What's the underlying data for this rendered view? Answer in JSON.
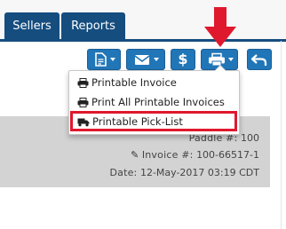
{
  "nav": {
    "tabs": [
      {
        "label": "Sellers"
      },
      {
        "label": "Reports"
      }
    ]
  },
  "toolbar": {
    "buttons": [
      {
        "name": "document-menu-button",
        "icon": "document-icon"
      },
      {
        "name": "email-menu-button",
        "icon": "envelope-icon"
      },
      {
        "name": "payment-button",
        "icon": "dollar-icon"
      },
      {
        "name": "print-menu-button",
        "icon": "printer-icon"
      },
      {
        "name": "back-button",
        "icon": "undo-arrow-icon"
      }
    ],
    "dollar_glyph": "$"
  },
  "print_menu": {
    "items": [
      {
        "label": "Printable Invoice",
        "icon": "printer-icon"
      },
      {
        "label": "Print All Printable Invoices",
        "icon": "printer-icon"
      },
      {
        "label": "Printable Pick-List",
        "icon": "truck-icon"
      }
    ]
  },
  "invoice": {
    "paddle_label": "Paddle #:",
    "paddle_value": "100",
    "invoice_label": "Invoice #:",
    "invoice_value": "100-66517-1",
    "date_label": "Date:",
    "date_value": "12-May-2017 03:19 CDT"
  },
  "colors": {
    "nav_blue": "#154d7f",
    "button_blue": "#2176b8",
    "highlight_red": "#e0182d",
    "panel_gray": "#d3d3d3"
  }
}
